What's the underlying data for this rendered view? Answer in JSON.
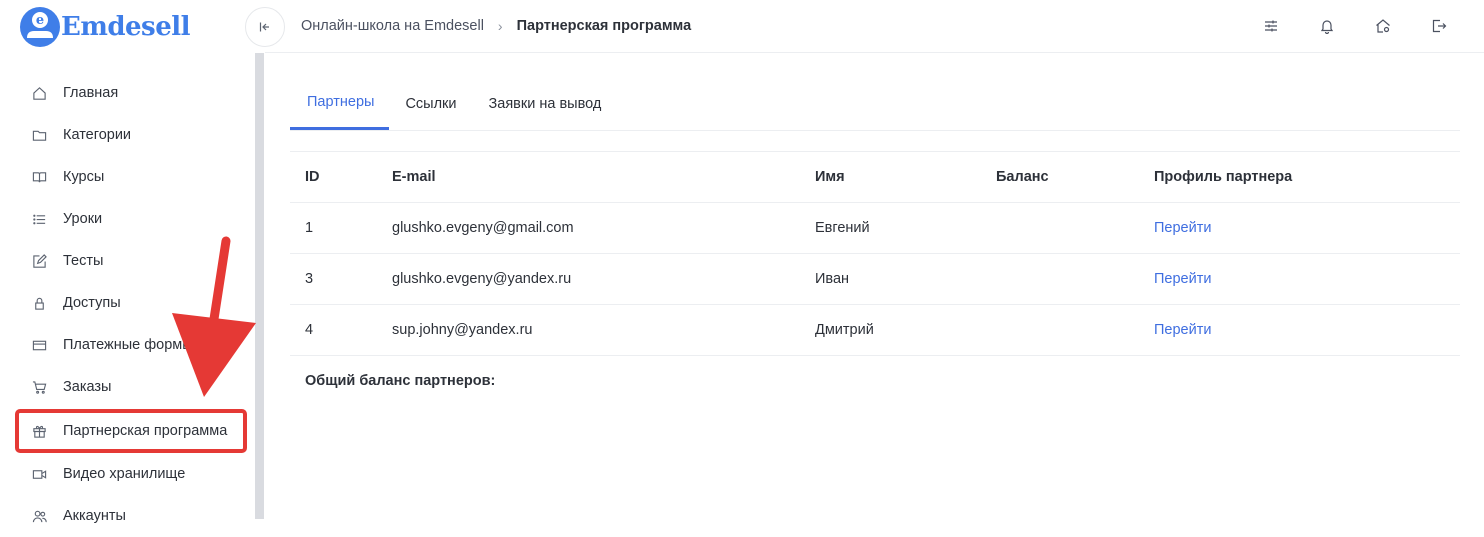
{
  "app": {
    "logo_text": "Emdesell",
    "logo_letter": "e"
  },
  "header": {
    "breadcrumb": {
      "root": "Онлайн-школа на Emdesell",
      "separator": "›",
      "current": "Партнерская программа"
    },
    "collapse_icon": "collapse-left-icon",
    "icons": [
      "settings-sliders-icon",
      "bell-icon",
      "home-settings-icon",
      "logout-icon"
    ]
  },
  "sidebar": {
    "items": [
      {
        "label": "Главная",
        "icon": "home-icon"
      },
      {
        "label": "Категории",
        "icon": "folder-icon"
      },
      {
        "label": "Курсы",
        "icon": "book-icon"
      },
      {
        "label": "Уроки",
        "icon": "list-icon"
      },
      {
        "label": "Тесты",
        "icon": "edit-icon"
      },
      {
        "label": "Доступы",
        "icon": "lock-icon"
      },
      {
        "label": "Платежные формы",
        "icon": "credit-card-icon"
      },
      {
        "label": "Заказы",
        "icon": "cart-icon"
      },
      {
        "label": "Партнерская программа",
        "icon": "gift-icon"
      },
      {
        "label": "Видео хранилище",
        "icon": "video-icon"
      },
      {
        "label": "Аккаунты",
        "icon": "users-icon"
      }
    ],
    "active_index": 8
  },
  "tabs": [
    {
      "label": "Партнеры",
      "active": true
    },
    {
      "label": "Ссылки",
      "active": false
    },
    {
      "label": "Заявки на вывод",
      "active": false
    }
  ],
  "table": {
    "headers": {
      "id": "ID",
      "email": "E-mail",
      "name": "Имя",
      "balance": "Баланс",
      "profile": "Профиль партнера"
    },
    "rows": [
      {
        "id": "1",
        "email": "glushko.evgeny@gmail.com",
        "name": "Евгений",
        "balance": "",
        "profile_link": "Перейти"
      },
      {
        "id": "3",
        "email": "glushko.evgeny@yandex.ru",
        "name": "Иван",
        "balance": "",
        "profile_link": "Перейти"
      },
      {
        "id": "4",
        "email": "sup.johny@yandex.ru",
        "name": "Дмитрий",
        "balance": "",
        "profile_link": "Перейти"
      }
    ]
  },
  "summary": {
    "label": "Общий баланс партнеров:",
    "value": ""
  },
  "colors": {
    "accent": "#3f6ee0",
    "logo": "#3f7ee8",
    "highlight": "#e53935"
  }
}
